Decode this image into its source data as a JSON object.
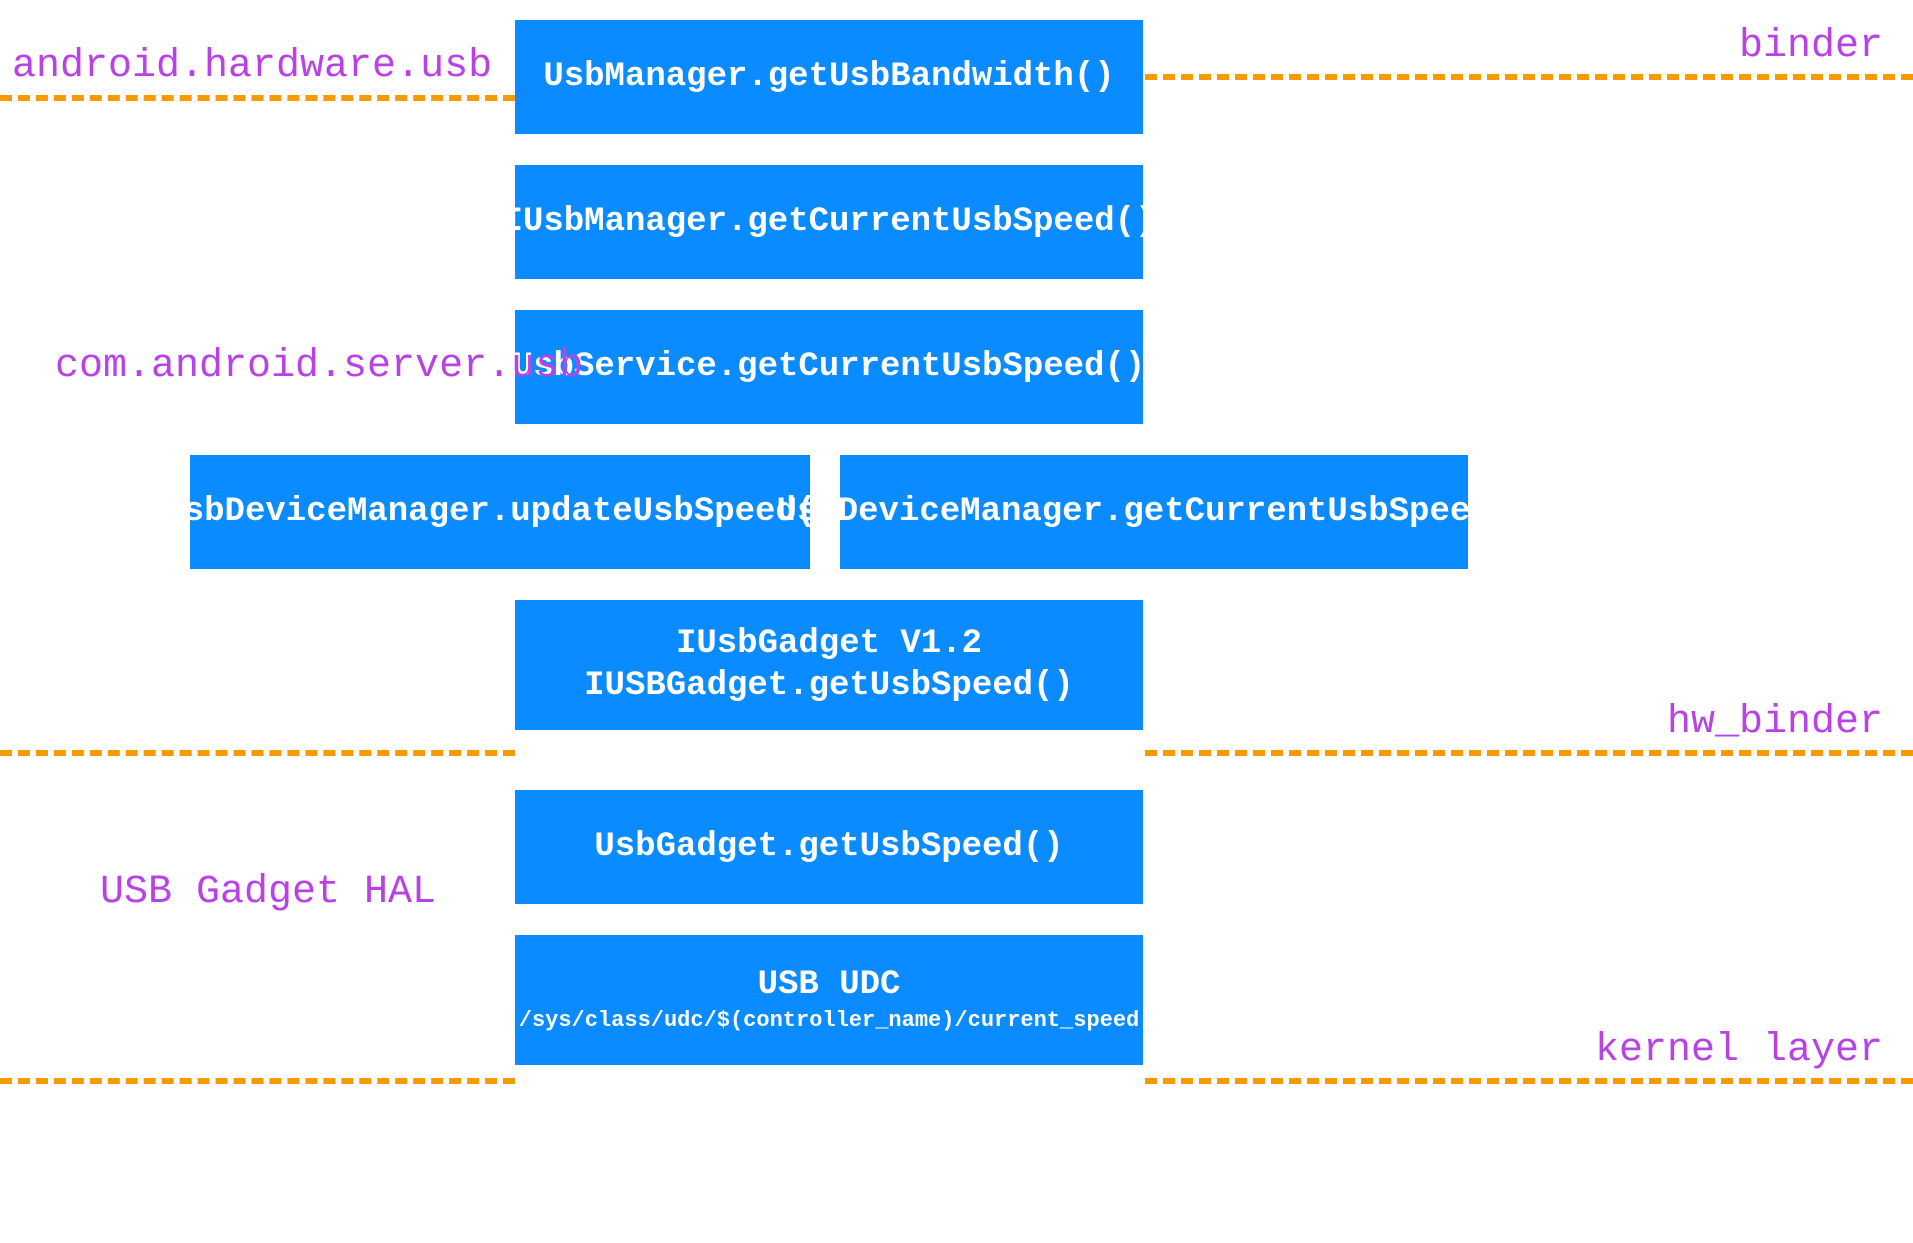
{
  "boxes": {
    "box1": "UsbManager.getUsbBandwidth()",
    "box2": "IUsbManager.getCurrentUsbSpeed()",
    "box3": "UsbService.getCurrentUsbSpeed()",
    "box4": "UsbDeviceManager.updateUsbSpeed()",
    "box5": "UsbDeviceManager.getCurrentUsbSpeed()",
    "box6_line1": "IUsbGadget V1.2",
    "box6_line2": "IUSBGadget.getUsbSpeed()",
    "box7": "UsbGadget.getUsbSpeed()",
    "box8_line1": "USB UDC",
    "box8_line2": "/sys/class/udc/$(controller_name)/current_speed"
  },
  "labels": {
    "left_top": "android.hardware.usb",
    "right_top": "binder",
    "left_mid": "com.android.server.usb",
    "right_mid": "hw_binder",
    "left_bottom": "USB Gadget HAL",
    "right_bottom": "kernel layer"
  }
}
